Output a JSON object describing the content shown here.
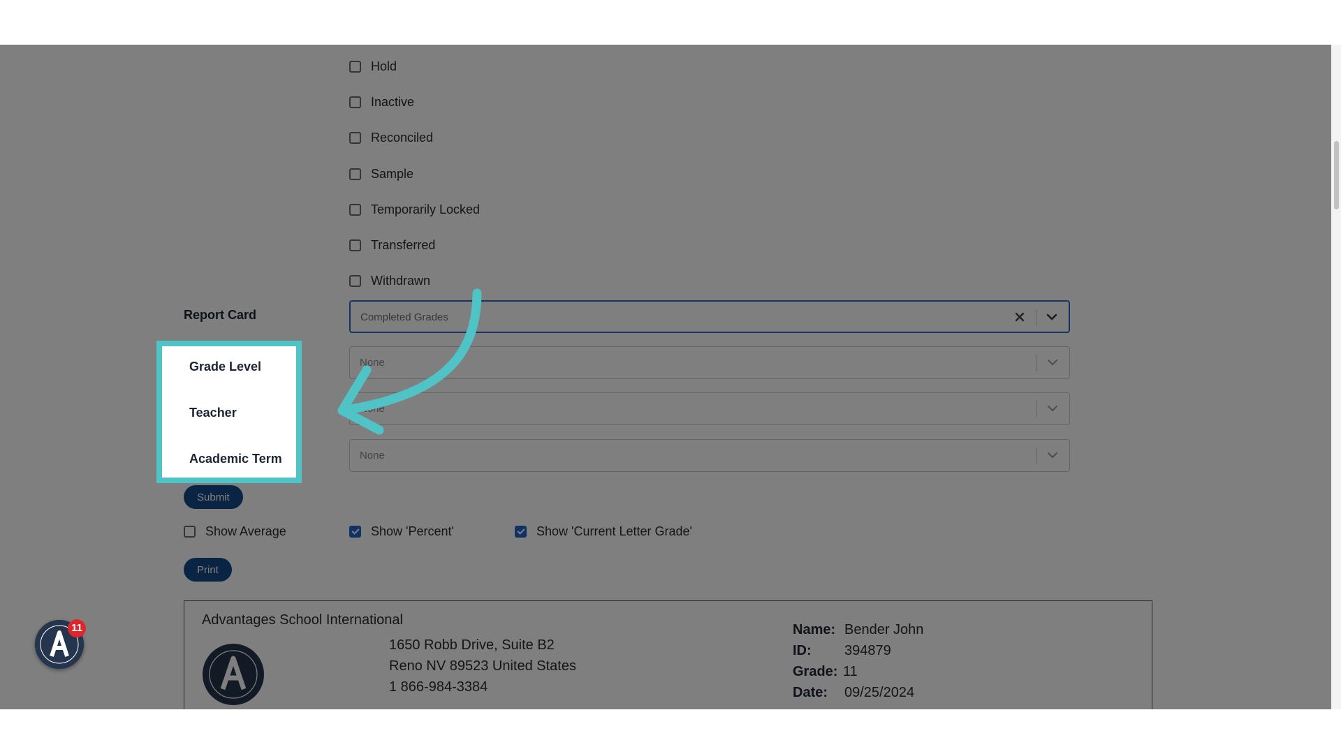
{
  "status_checkboxes": [
    {
      "label": "Hold",
      "checked": false
    },
    {
      "label": "Inactive",
      "checked": false
    },
    {
      "label": "Reconciled",
      "checked": false
    },
    {
      "label": "Sample",
      "checked": false
    },
    {
      "label": "Temporarily Locked",
      "checked": false
    },
    {
      "label": "Transferred",
      "checked": false
    },
    {
      "label": "Withdrawn",
      "checked": false
    }
  ],
  "report_card": {
    "label": "Report Card",
    "value": "Completed Grades"
  },
  "filters": {
    "grade_level": {
      "label": "Grade Level",
      "value": "None"
    },
    "teacher": {
      "label": "Teacher",
      "value": "None"
    },
    "academic_term": {
      "label": "Academic Term",
      "value": "None"
    }
  },
  "submit_label": "Submit",
  "options": {
    "show_average": {
      "label": "Show Average",
      "checked": false
    },
    "show_percent": {
      "label": "Show 'Percent'",
      "checked": true
    },
    "show_letter": {
      "label": "Show 'Current Letter Grade'",
      "checked": true
    }
  },
  "print_label": "Print",
  "report": {
    "school_name": "Advantages School International",
    "address_line1": "1650 Robb Drive, Suite B2",
    "address_line2": "Reno NV 89523 United States",
    "phone": "1 866-984-3384",
    "name_label": "Name:",
    "name_value": "Bender John",
    "id_label": "ID:",
    "id_value": "394879",
    "grade_label": "Grade:",
    "grade_value": "11",
    "date_label": "Date:",
    "date_value": "09/25/2024"
  },
  "notification_count": "11",
  "colors": {
    "highlight": "#4fc3c6",
    "primary_button": "#134a86",
    "checkbox_checked": "#1f63c6",
    "badge": "#e0262d"
  }
}
